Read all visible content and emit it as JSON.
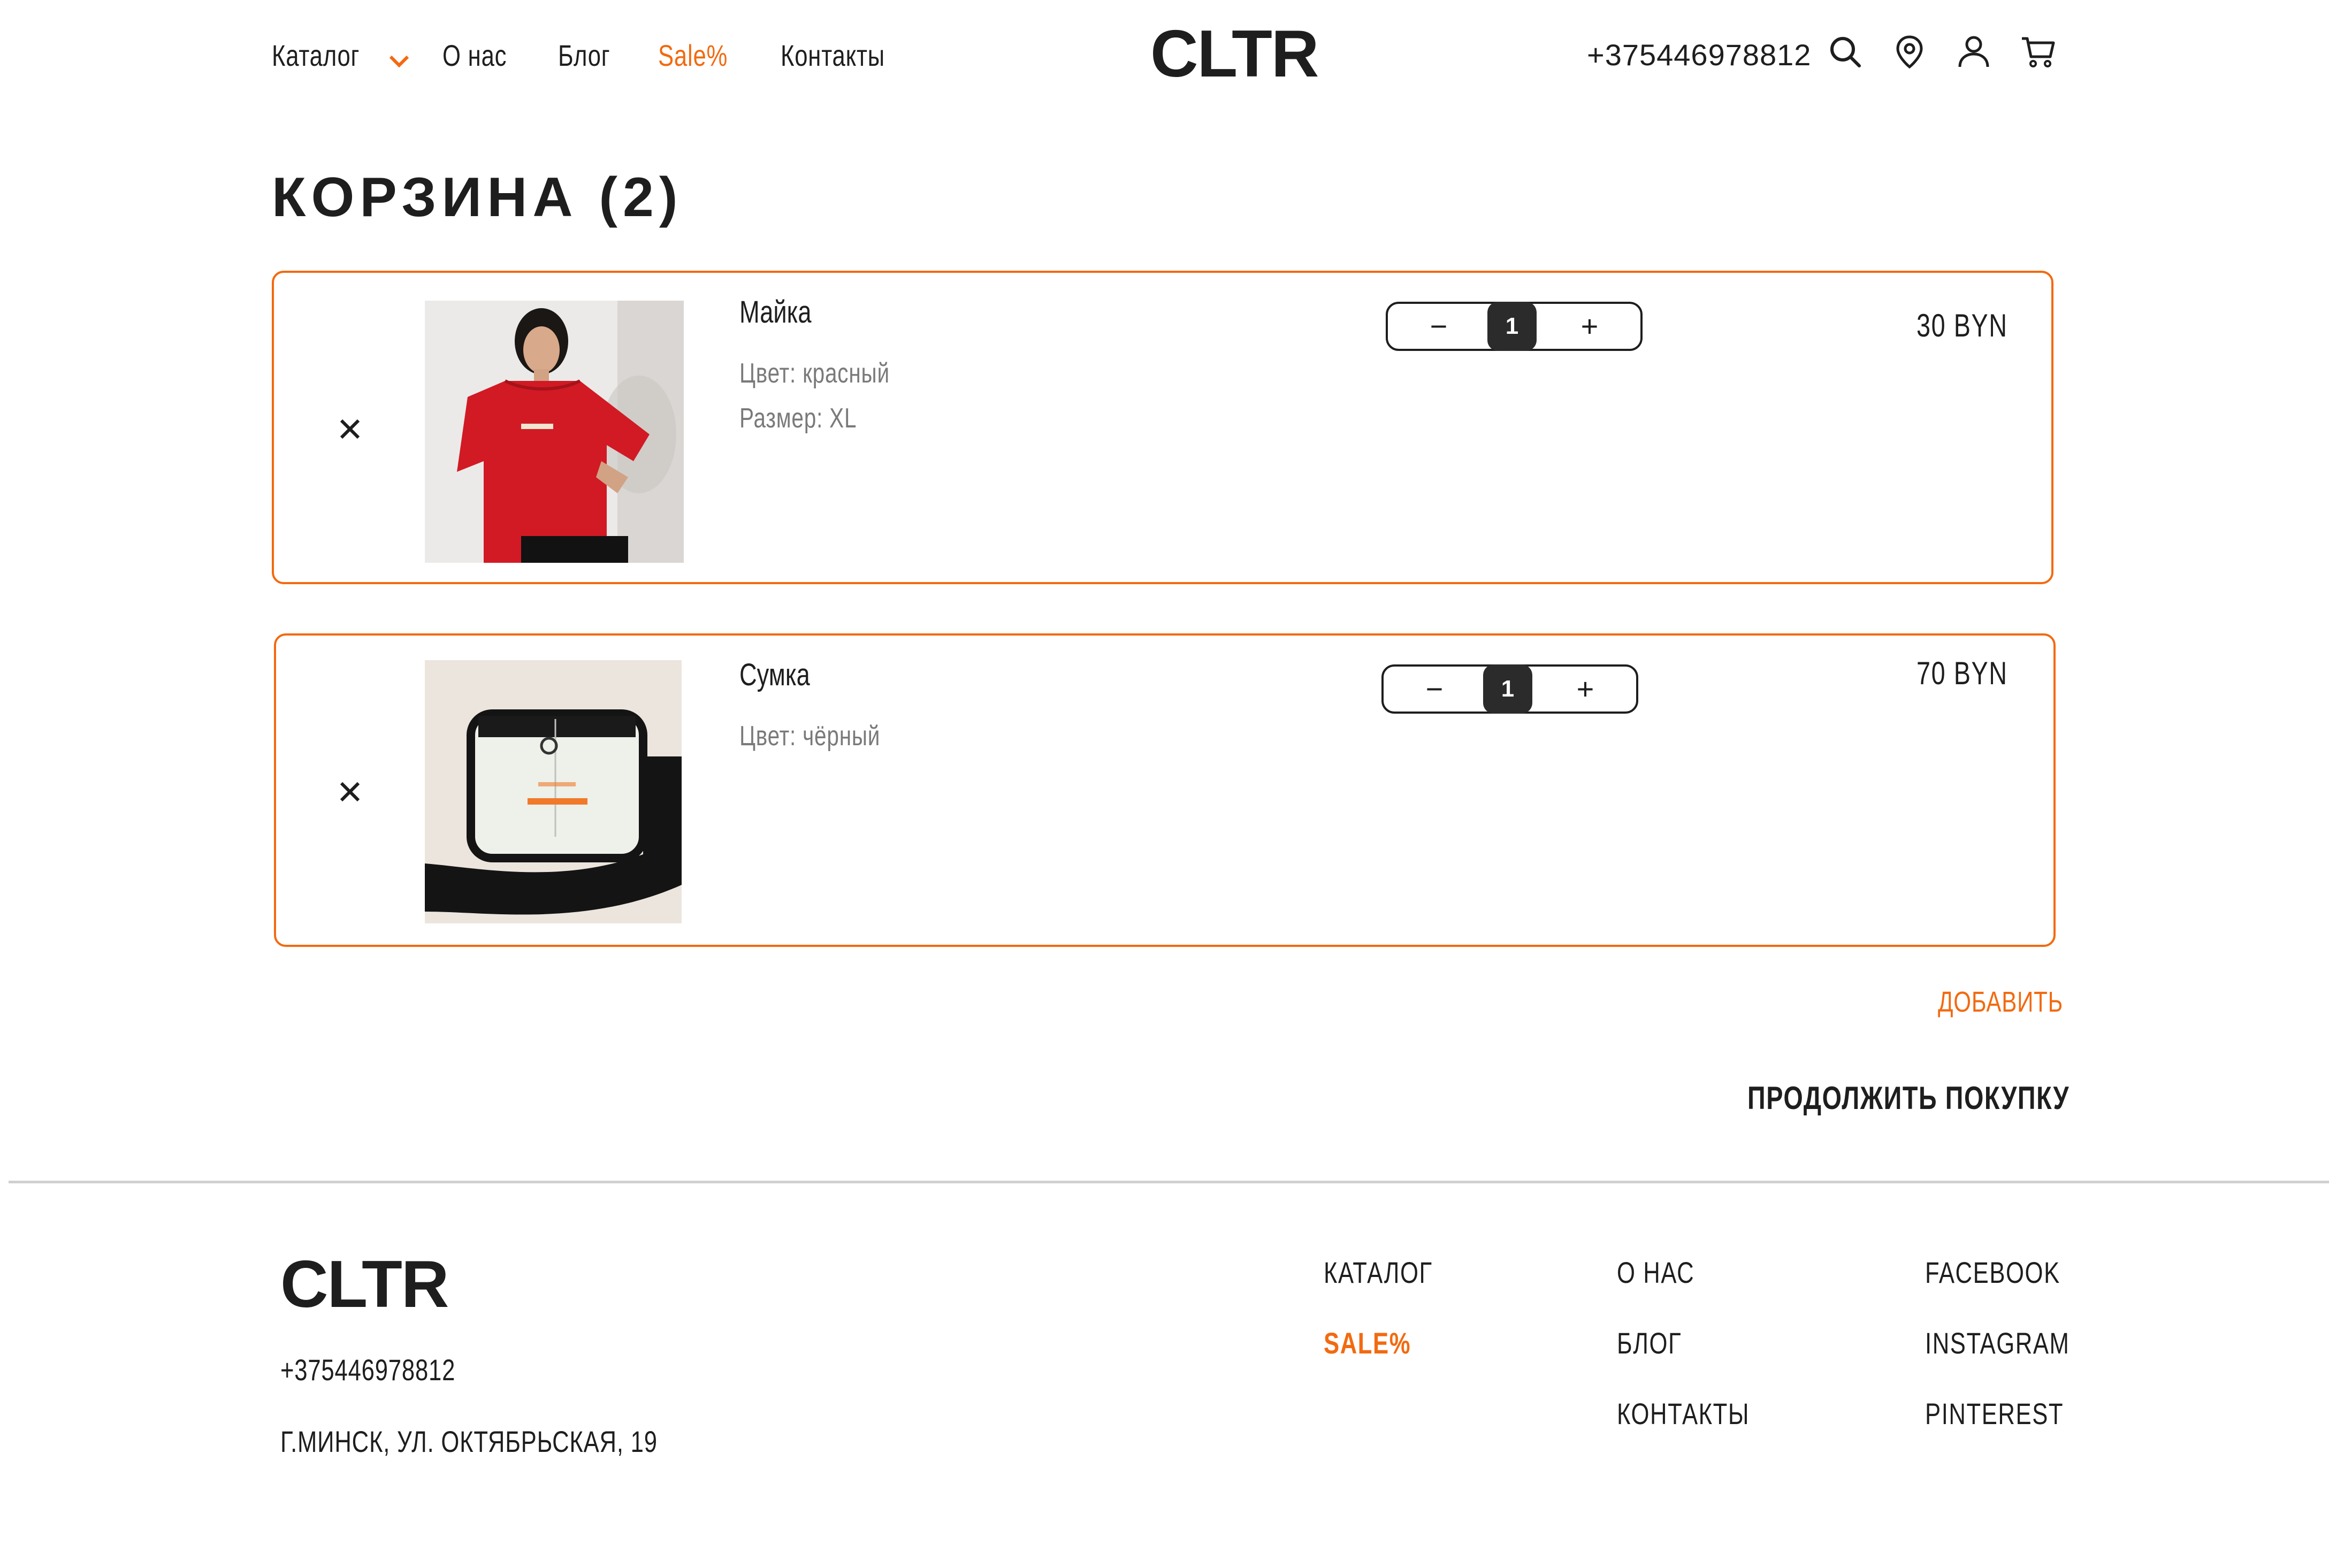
{
  "colors": {
    "accent": "#f26a10",
    "text": "#1e1e1e",
    "muted": "#7a7a7a",
    "border_line": "#d0d0d0"
  },
  "header": {
    "nav": [
      {
        "label": "Каталог",
        "has_dropdown": true
      },
      {
        "label": "О нас"
      },
      {
        "label": "Блог"
      },
      {
        "label": "Sale%",
        "highlight": true
      },
      {
        "label": "Контакты"
      }
    ],
    "logo": "CLTR",
    "phone": "+375446978812",
    "icons": [
      "search-icon",
      "location-pin-icon",
      "user-icon",
      "cart-icon"
    ]
  },
  "page": {
    "title": "КОРЗИНА (2)"
  },
  "cart": {
    "items": [
      {
        "name": "Майка",
        "attributes": [
          "Цвет: красный",
          "Размер: XL"
        ],
        "quantity": "1",
        "price": "30 BYN",
        "image": "red-tshirt-photo",
        "minus": "−",
        "plus": "+"
      },
      {
        "name": "Сумка",
        "attributes": [
          "Цвет: чёрный"
        ],
        "quantity": "1",
        "price": "70 BYN",
        "image": "transparent-bag-photo",
        "minus": "−",
        "plus": "+"
      }
    ],
    "add_label": "ДОБАВИТЬ",
    "continue_label": "ПРОДОЛЖИТЬ ПОКУПКУ"
  },
  "footer": {
    "logo": "CLTR",
    "phone": "+375446978812",
    "address": "Г.МИНСК, УЛ. ОКТЯБРЬСКАЯ, 19",
    "col1": [
      "КАТАЛОГ",
      "SALE%"
    ],
    "col2": [
      "О НАС",
      "БЛОГ",
      "КОНТАКТЫ"
    ],
    "col3": [
      "FACEBOOK",
      "INSTAGRAM",
      "PINTEREST"
    ]
  }
}
